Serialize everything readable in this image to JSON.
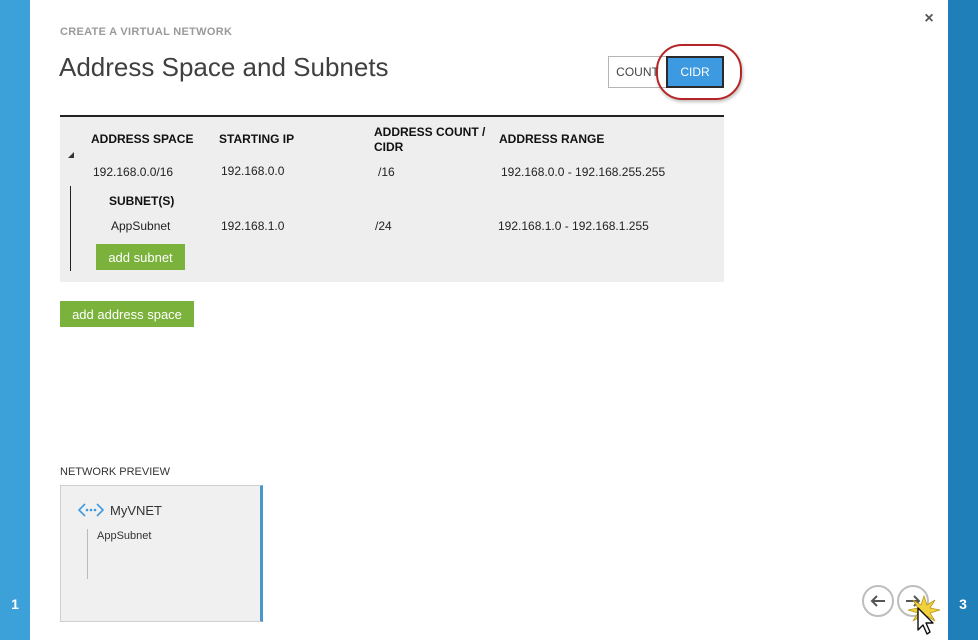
{
  "wizard": {
    "label": "CREATE A VIRTUAL NETWORK",
    "title": "Address Space and Subnets",
    "step_left": "1",
    "step_right": "3",
    "close_glyph": "×"
  },
  "view_toggle": {
    "count_label": "COUNT",
    "cidr_label": "CIDR",
    "selected": "CIDR"
  },
  "grid": {
    "headers": {
      "address_space": "ADDRESS SPACE",
      "starting_ip": "STARTING IP",
      "address_count_line1": "ADDRESS COUNT /",
      "address_count_line2": "CIDR",
      "address_range": "ADDRESS RANGE"
    },
    "address_space_row": {
      "address_space": "192.168.0.0/16",
      "starting_ip": "192.168.0.0",
      "cidr": "/16",
      "range": "192.168.0.0 - 192.168.255.255"
    },
    "subnets_header": "SUBNET(S)",
    "subnet_row": {
      "name": "AppSubnet",
      "starting_ip": "192.168.1.0",
      "cidr": "/24",
      "range": "192.168.1.0 - 192.168.1.255"
    },
    "add_subnet_label": "add subnet"
  },
  "add_address_space_label": "add address space",
  "preview": {
    "label": "NETWORK PREVIEW",
    "vnet_name": "MyVNET",
    "subnet_name": "AppSubnet",
    "icon": "vnet-icon"
  },
  "nav": {
    "back_icon": "arrow-left-icon",
    "next_icon": "arrow-right-icon"
  },
  "colors": {
    "accent_blue": "#3d9ae0",
    "rail_left": "#3ba1d8",
    "rail_right": "#1f7fb8",
    "green_button": "#7ab23b",
    "highlight_red": "#b52525"
  }
}
